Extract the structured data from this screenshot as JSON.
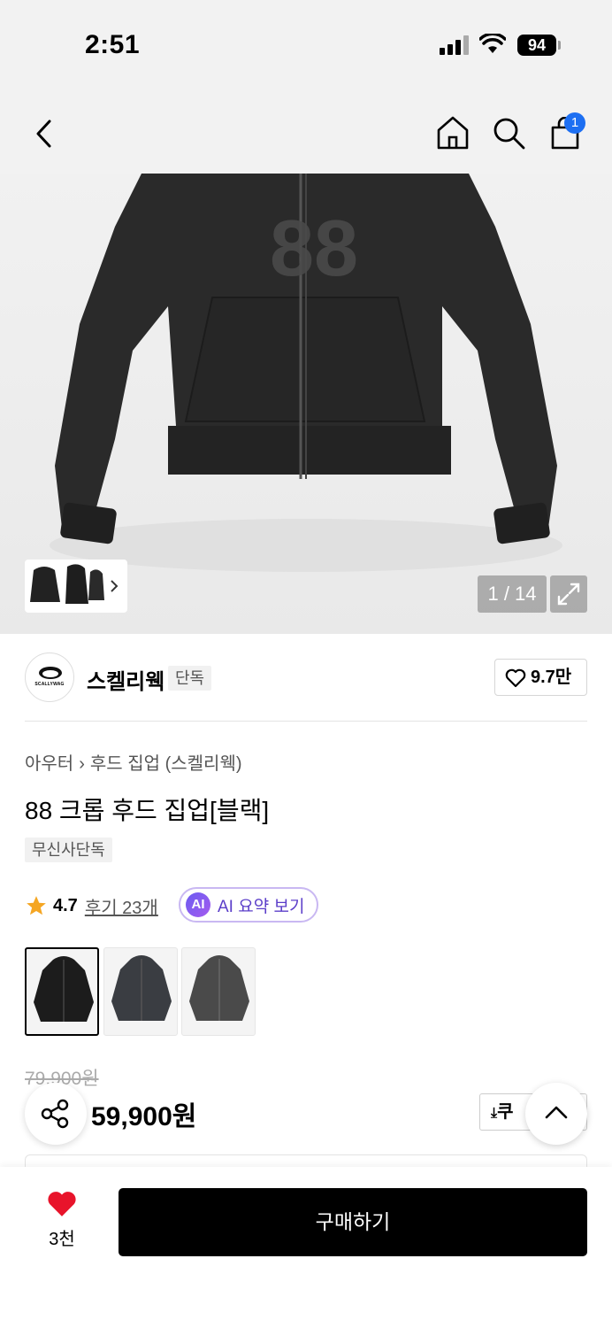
{
  "status_bar": {
    "time": "2:51",
    "battery": "94"
  },
  "nav": {
    "cart_count": "1"
  },
  "gallery": {
    "counter": "1 / 14"
  },
  "brand": {
    "name": "스켈리웩",
    "logo_text": "SCALLYWAG",
    "tag": "단독",
    "likes": "9.7만"
  },
  "product": {
    "breadcrumb": [
      "아우터",
      "후드 집업 (스켈리웩)"
    ],
    "title": "88 크롭 후드 집업[블랙]",
    "exclusive_badge": "무신사단독",
    "rating": "4.7",
    "reviews": "후기 23개",
    "ai_badge": "AI",
    "ai_summary": "AI 요약 보기",
    "original_price": "79,900원",
    "price": "59,900원",
    "coupon_label": "쿠"
  },
  "bottom_bar": {
    "wish_count": "3천",
    "buy_label": "구매하기"
  },
  "colors": {
    "accent_blue": "#1d6ff2",
    "heart_red": "#e8142b",
    "star": "#f5a623",
    "ai_purple": "#5b3ec9"
  }
}
